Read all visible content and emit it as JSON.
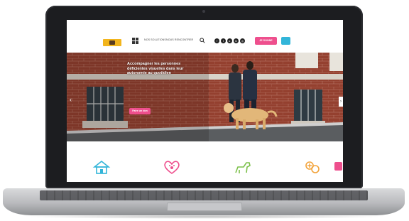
{
  "header": {
    "nav_links": [
      "NOS SOLUTIONS",
      "NOUS RENCONTRER"
    ],
    "donate_label": "JE DONNE",
    "social_icons": [
      "facebook-icon",
      "twitter-icon",
      "youtube-icon",
      "linkedin-icon",
      "instagram-icon"
    ]
  },
  "hero": {
    "title": "Accompagner les personnes déficientes visuelles dans leur autonomie au quotidien",
    "cta_label": "Faire un don"
  },
  "categories": {
    "icons": [
      "house-icon",
      "heart-paw-icon",
      "dog-icon",
      "puzzle-icon"
    ]
  },
  "colors": {
    "pink": "#ee4f8d",
    "blue": "#32b5d9",
    "logo_yellow": "#f2b51d",
    "laptop_frame": "#1c1d20"
  }
}
